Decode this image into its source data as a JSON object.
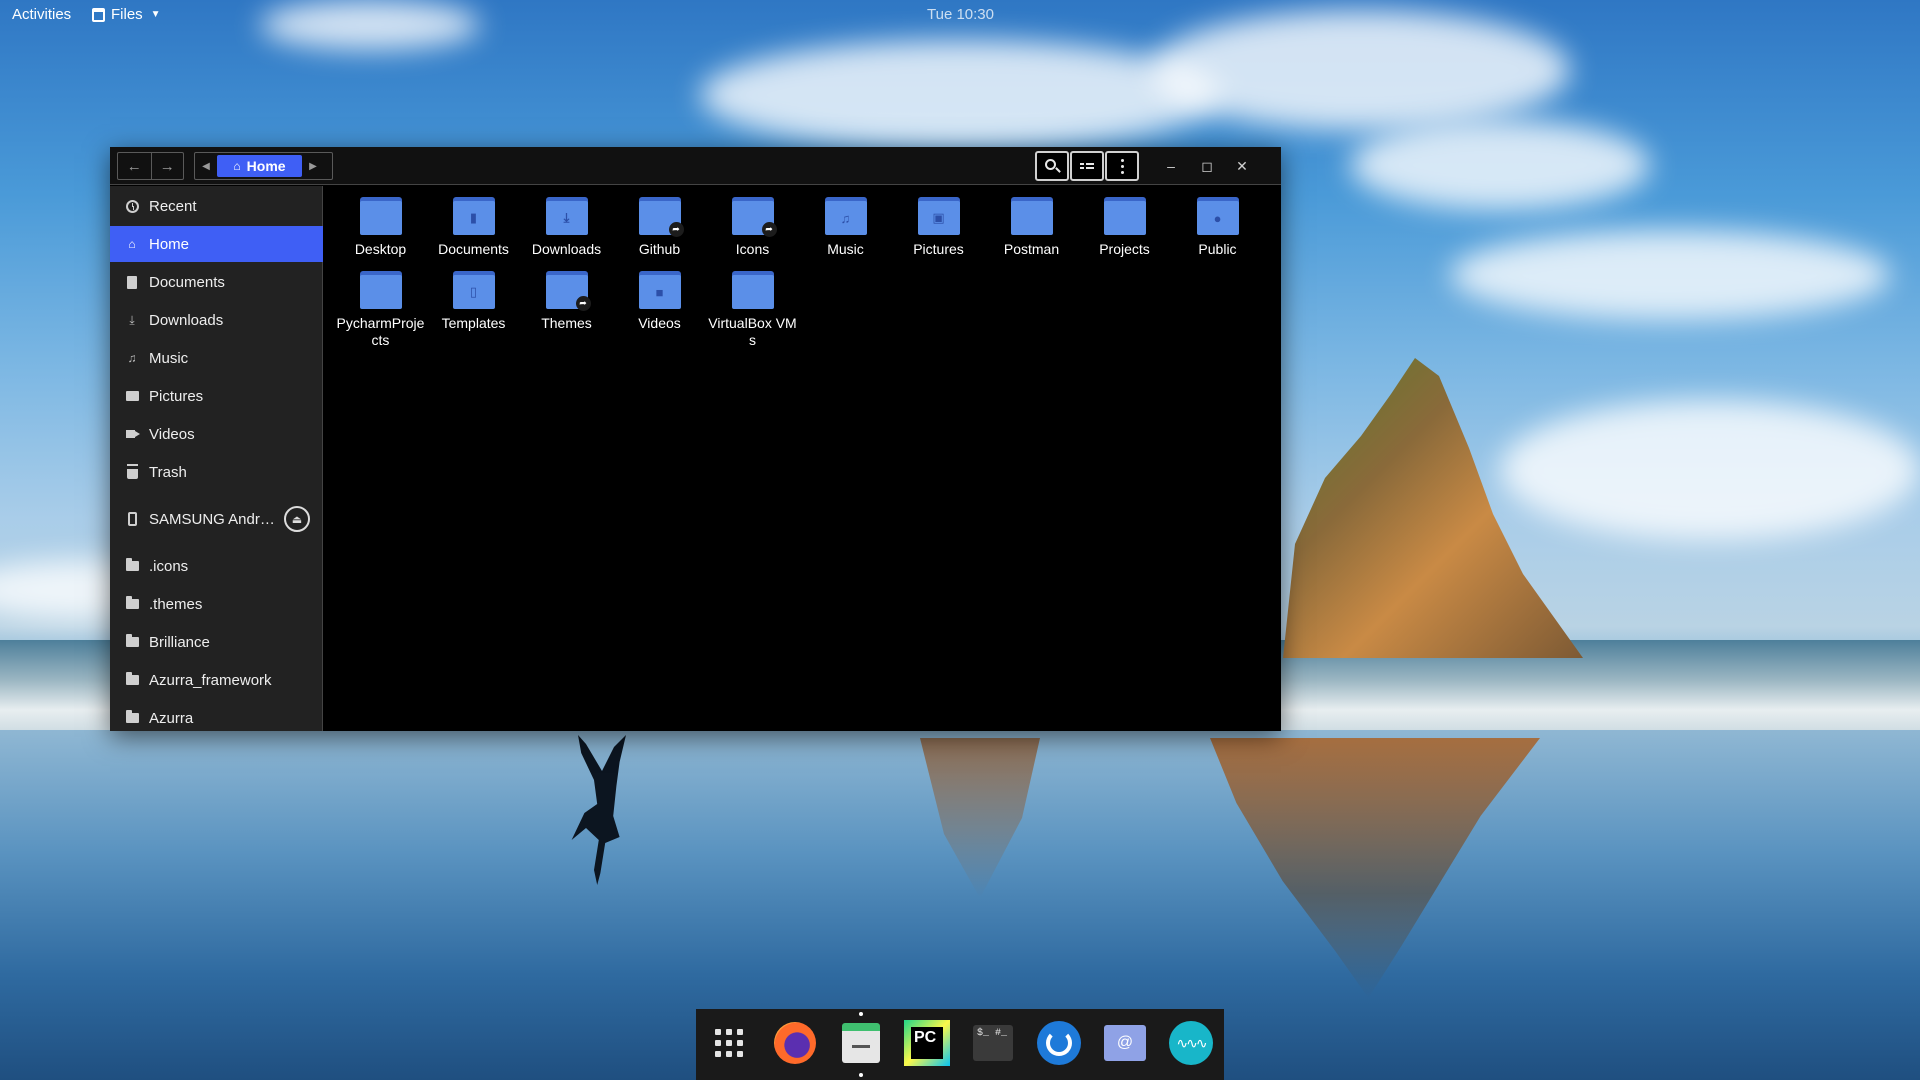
{
  "topbar": {
    "activities": "Activities",
    "app_menu": "Files",
    "clock": "Tue 10:30"
  },
  "window": {
    "path": {
      "home_label": "Home"
    },
    "sidebar": {
      "items": [
        {
          "label": "Recent",
          "icon": "clock-icon"
        },
        {
          "label": "Home",
          "icon": "home-icon"
        },
        {
          "label": "Documents",
          "icon": "document-icon"
        },
        {
          "label": "Downloads",
          "icon": "download-icon"
        },
        {
          "label": "Music",
          "icon": "music-icon"
        },
        {
          "label": "Pictures",
          "icon": "picture-icon"
        },
        {
          "label": "Videos",
          "icon": "video-icon"
        },
        {
          "label": "Trash",
          "icon": "trash-icon"
        },
        {
          "label": "SAMSUNG Andr…",
          "icon": "phone-icon"
        },
        {
          "label": ".icons",
          "icon": "folder-icon"
        },
        {
          "label": ".themes",
          "icon": "folder-icon"
        },
        {
          "label": "Brilliance",
          "icon": "folder-icon"
        },
        {
          "label": "Azurra_framework",
          "icon": "folder-icon"
        },
        {
          "label": "Azurra",
          "icon": "folder-icon"
        }
      ],
      "selected": "Home"
    },
    "files": [
      {
        "name": "Desktop",
        "emblem": ""
      },
      {
        "name": "Documents",
        "emblem": "document"
      },
      {
        "name": "Downloads",
        "emblem": "download"
      },
      {
        "name": "Github",
        "emblem": "symlink"
      },
      {
        "name": "Icons",
        "emblem": "symlink"
      },
      {
        "name": "Music",
        "emblem": "music"
      },
      {
        "name": "Pictures",
        "emblem": "picture"
      },
      {
        "name": "Postman",
        "emblem": ""
      },
      {
        "name": "Projects",
        "emblem": ""
      },
      {
        "name": "Public",
        "emblem": "user"
      },
      {
        "name": "PycharmProjects",
        "emblem": ""
      },
      {
        "name": "Templates",
        "emblem": "template"
      },
      {
        "name": "Themes",
        "emblem": "symlink"
      },
      {
        "name": "Videos",
        "emblem": "video"
      },
      {
        "name": "VirtualBox VMs",
        "emblem": ""
      }
    ]
  },
  "dock": {
    "apps": [
      "show-applications",
      "firefox",
      "files",
      "pycharm",
      "terminal",
      "timeshift",
      "mail",
      "audio-recorder"
    ],
    "terminal_text": "$_ #_",
    "pycharm_text": "PC"
  },
  "colors": {
    "accent": "#3f5ff5",
    "folder": "#5b8fe8",
    "sidebar_bg": "#222222",
    "content_bg": "#000000"
  }
}
